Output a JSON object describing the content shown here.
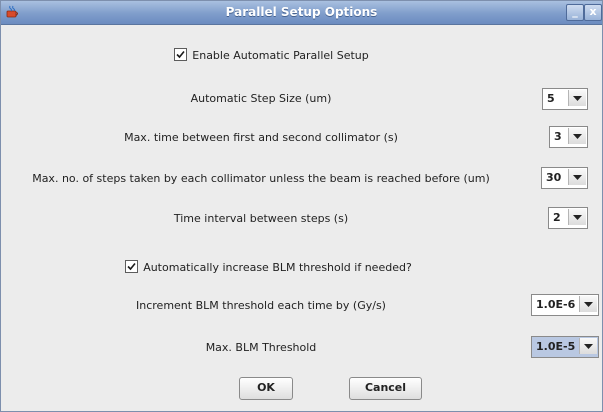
{
  "window": {
    "title": "Parallel Setup Options",
    "min_glyph": "_",
    "close_glyph": "x",
    "icon": "java-cup-icon"
  },
  "options": {
    "enable_auto": {
      "label": "Enable Automatic Parallel Setup",
      "checked": true
    },
    "step_size": {
      "label": "Automatic Step Size (um)",
      "value": "5"
    },
    "max_time": {
      "label": "Max. time between first and second collimator (s)",
      "value": "3"
    },
    "max_steps": {
      "label": "Max. no. of steps taken by each collimator unless the beam is reached before (um)",
      "value": "30"
    },
    "time_interval": {
      "label": "Time interval between steps (s)",
      "value": "2"
    },
    "auto_increase_blm": {
      "label": "Automatically increase BLM threshold if needed?",
      "checked": true
    },
    "increment_blm": {
      "label": "Increment BLM threshold each time by (Gy/s)",
      "value": "1.0E-6"
    },
    "max_blm": {
      "label": "Max. BLM Threshold",
      "value": "1.0E-5"
    }
  },
  "buttons": {
    "ok": "OK",
    "cancel": "Cancel"
  },
  "colors": {
    "title_bar": "#7f9dcb",
    "panel": "#ececec",
    "selected_combo": "#b9c8e2"
  }
}
